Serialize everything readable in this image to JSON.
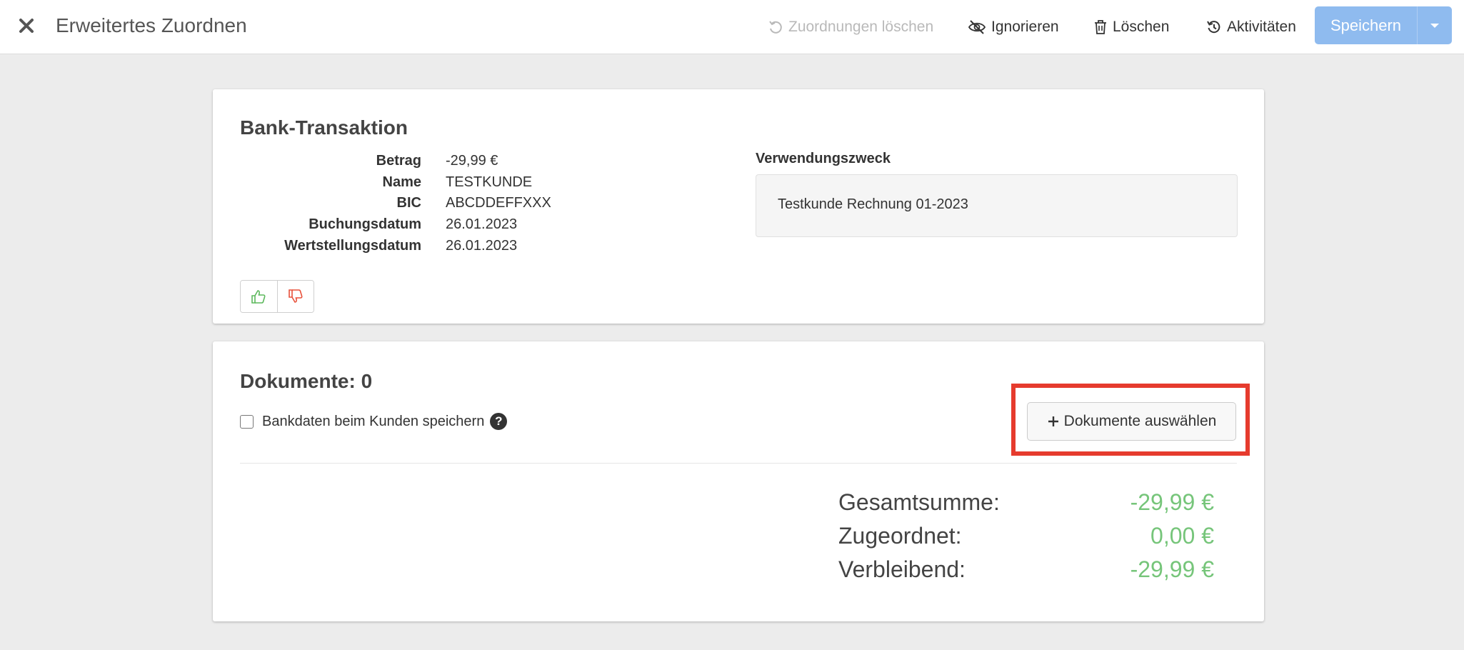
{
  "header": {
    "title": "Erweitertes Zuordnen",
    "actions": {
      "clear_assignments": "Zuordnungen löschen",
      "ignore": "Ignorieren",
      "delete": "Löschen",
      "activities": "Aktivitäten"
    },
    "save_label": "Speichern"
  },
  "transaction": {
    "title": "Bank-Transaktion",
    "fields": [
      {
        "label": "Betrag",
        "value": "-29,99 €"
      },
      {
        "label": "Name",
        "value": "TESTKUNDE"
      },
      {
        "label": "BIC",
        "value": "ABCDDEFFXXX"
      },
      {
        "label": "Buchungsdatum",
        "value": "26.01.2023"
      },
      {
        "label": "Wertstellungsdatum",
        "value": "26.01.2023"
      }
    ],
    "purpose_label": "Verwendungszweck",
    "purpose_value": "Testkunde Rechnung 01-2023"
  },
  "documents": {
    "title": "Dokumente: 0",
    "save_bank_data_label": "Bankdaten beim Kunden speichern",
    "select_button_label": "Dokumente auswählen",
    "totals": [
      {
        "label": "Gesamtsumme:",
        "value": "-29,99 €"
      },
      {
        "label": "Zugeordnet:",
        "value": "0,00 €"
      },
      {
        "label": "Verbleibend:",
        "value": "-29,99 €"
      }
    ]
  },
  "colors": {
    "primary_button": "#8fbbef",
    "positive_amount": "#76c57a",
    "highlight_box": "#e63b2e",
    "thumbs_up": "#5cb85c",
    "thumbs_down": "#e8503a"
  }
}
